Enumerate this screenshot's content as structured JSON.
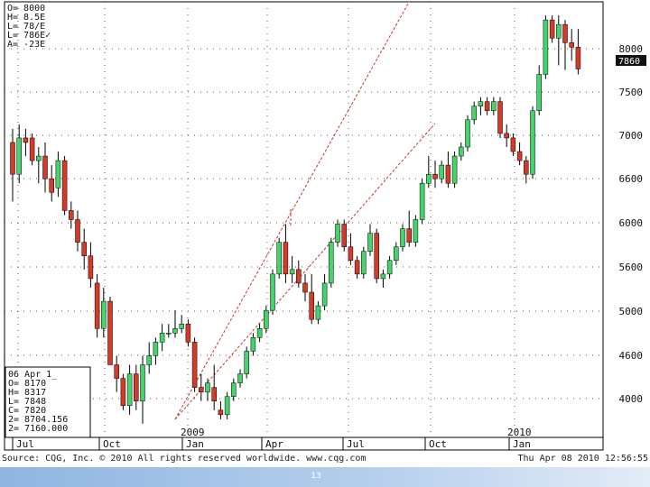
{
  "colors": {
    "up": "#44d46a",
    "down": "#d23a2a",
    "channel": "#c0392b",
    "grid": "#555555",
    "last_price_bg": "#111111",
    "bottom_bar": "#8fb5e0"
  },
  "header_stats": [
    "O= 8000",
    "H= 8.5E",
    "L= 78/E",
    "L= 786E✓",
    "A= -23E"
  ],
  "info_box": [
    "06 Apr 1_",
    "O=      8170",
    "H=      8317",
    "L=      7848",
    "C=      7820",
    "2=    8704.156",
    "2=    7160.000"
  ],
  "footer": {
    "source": "Source: CQG, Inc. © 2010 All rights reserved worldwide. www.cqg.com",
    "date": "Thu Apr 08 2010 12:56:55"
  },
  "page_number": "13",
  "chart_data": {
    "type": "candlestick",
    "title": "",
    "y_axis_ticks": [
      "4000",
      "4600",
      "5000",
      "5600",
      "6000",
      "6600",
      "7000",
      "7500",
      "8000"
    ],
    "ylim": [
      3800,
      8600
    ],
    "last_price": "7860",
    "x_month_labels": [
      "Jul",
      "Oct",
      "Jan",
      "Apr",
      "Jul",
      "Oct",
      "Jan"
    ],
    "year_labels": [
      "2009",
      "2010"
    ],
    "channel_lines": [
      {
        "from": [
          25,
          4000
        ],
        "to": [
          61,
          8600
        ]
      },
      {
        "from": [
          25,
          4000
        ],
        "to": [
          65,
          7260
        ]
      }
    ],
    "candles": [
      [
        7050,
        7200,
        6400,
        6700
      ],
      [
        6700,
        7250,
        6600,
        7100
      ],
      [
        7100,
        7200,
        6900,
        7050
      ],
      [
        7100,
        7150,
        6800,
        6850
      ],
      [
        6850,
        7000,
        6600,
        6900
      ],
      [
        6900,
        7050,
        6500,
        6650
      ],
      [
        6650,
        6800,
        6400,
        6500
      ],
      [
        6550,
        6950,
        6450,
        6850
      ],
      [
        6850,
        6900,
        6250,
        6300
      ],
      [
        6300,
        6400,
        6100,
        6200
      ],
      [
        6200,
        6300,
        5850,
        5950
      ],
      [
        5950,
        6100,
        5650,
        5800
      ],
      [
        5800,
        5950,
        5450,
        5550
      ],
      [
        5500,
        5600,
        4900,
        5000
      ],
      [
        5000,
        5450,
        4900,
        5300
      ],
      [
        5300,
        5350,
        4600,
        4600
      ],
      [
        4600,
        4700,
        4300,
        4450
      ],
      [
        4450,
        4500,
        4100,
        4150
      ],
      [
        4150,
        4600,
        4050,
        4500
      ],
      [
        4500,
        4600,
        4100,
        4200
      ],
      [
        4200,
        4700,
        3950,
        4600
      ],
      [
        4600,
        4850,
        4500,
        4700
      ],
      [
        4700,
        4900,
        4600,
        4850
      ],
      [
        4850,
        5050,
        4750,
        4950
      ],
      [
        4950,
        5050,
        4900,
        4950
      ],
      [
        4950,
        5200,
        4900,
        5000
      ],
      [
        5000,
        5150,
        4950,
        5050
      ],
      [
        5050,
        5100,
        4800,
        4850
      ],
      [
        4850,
        4900,
        4300,
        4350
      ],
      [
        4350,
        4500,
        4200,
        4300
      ],
      [
        4300,
        4450,
        4200,
        4400
      ],
      [
        4350,
        4600,
        4100,
        4200
      ],
      [
        4100,
        4200,
        4000,
        4050
      ],
      [
        4050,
        4300,
        4000,
        4250
      ],
      [
        4250,
        4450,
        4200,
        4400
      ],
      [
        4400,
        4550,
        4350,
        4500
      ],
      [
        4500,
        4800,
        4450,
        4750
      ],
      [
        4750,
        4950,
        4700,
        4900
      ],
      [
        4900,
        5050,
        4850,
        5000
      ],
      [
        5000,
        5250,
        4950,
        5200
      ],
      [
        5200,
        5650,
        5150,
        5600
      ],
      [
        5600,
        6000,
        5550,
        5950
      ],
      [
        5950,
        6150,
        5500,
        5600
      ],
      [
        5600,
        5800,
        5500,
        5650
      ],
      [
        5650,
        5750,
        5450,
        5500
      ],
      [
        5500,
        5600,
        5300,
        5400
      ],
      [
        5400,
        5600,
        5050,
        5100
      ],
      [
        5100,
        5300,
        5050,
        5250
      ],
      [
        5250,
        5600,
        5200,
        5500
      ],
      [
        5500,
        6000,
        5450,
        5950
      ],
      [
        5950,
        6200,
        5900,
        6150
      ],
      [
        6150,
        6200,
        5850,
        5900
      ],
      [
        5900,
        6050,
        5700,
        5750
      ],
      [
        5750,
        5800,
        5550,
        5600
      ],
      [
        5600,
        5900,
        5550,
        5850
      ],
      [
        5850,
        6150,
        5800,
        6050
      ],
      [
        6050,
        6100,
        5500,
        5550
      ],
      [
        5550,
        5650,
        5450,
        5600
      ],
      [
        5600,
        5800,
        5550,
        5750
      ],
      [
        5750,
        5950,
        5700,
        5900
      ],
      [
        5900,
        6150,
        5850,
        6100
      ],
      [
        6100,
        6300,
        5900,
        5950
      ],
      [
        5950,
        6250,
        5900,
        6200
      ],
      [
        6200,
        6650,
        6150,
        6600
      ],
      [
        6600,
        6900,
        6550,
        6700
      ],
      [
        6700,
        6850,
        6550,
        6650
      ],
      [
        6650,
        6850,
        6600,
        6800
      ],
      [
        6800,
        6950,
        6550,
        6600
      ],
      [
        6600,
        6950,
        6550,
        6900
      ],
      [
        6900,
        7050,
        6850,
        7000
      ],
      [
        7000,
        7350,
        6950,
        7300
      ],
      [
        7300,
        7500,
        7250,
        7450
      ],
      [
        7450,
        7550,
        7350,
        7500
      ],
      [
        7500,
        7550,
        7350,
        7400
      ],
      [
        7400,
        7550,
        7350,
        7500
      ],
      [
        7500,
        7550,
        7100,
        7150
      ],
      [
        7150,
        7250,
        7000,
        7100
      ],
      [
        7100,
        7150,
        6900,
        6950
      ],
      [
        6950,
        7050,
        6800,
        6850
      ],
      [
        6850,
        6900,
        6600,
        6700
      ],
      [
        6700,
        7450,
        6650,
        7400
      ],
      [
        7400,
        7900,
        7350,
        7800
      ],
      [
        7800,
        8450,
        7750,
        8400
      ],
      [
        8400,
        8450,
        8150,
        8200
      ],
      [
        8200,
        8450,
        7900,
        8350
      ],
      [
        8350,
        8400,
        7850,
        8150
      ],
      [
        8150,
        8300,
        7950,
        8100
      ],
      [
        8100,
        8300,
        7800,
        7860
      ]
    ]
  }
}
